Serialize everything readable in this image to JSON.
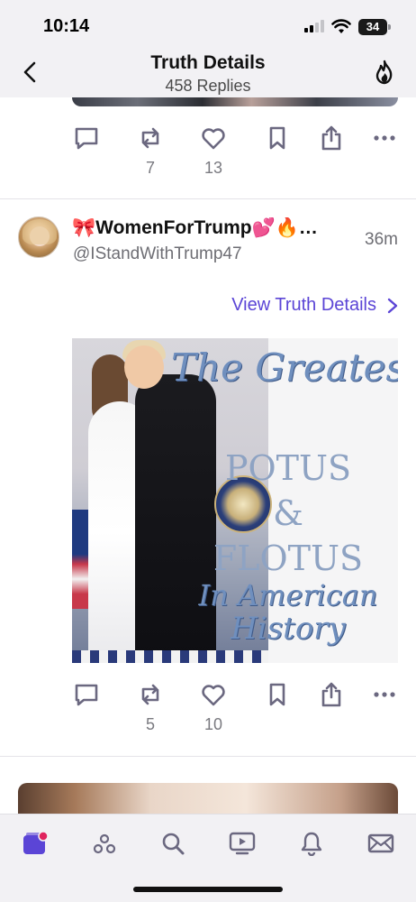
{
  "status_bar": {
    "time": "10:14",
    "battery": "34"
  },
  "header": {
    "title": "Truth Details",
    "subtitle": "458 Replies"
  },
  "prev_post": {
    "replies": "",
    "reposts": "7",
    "likes": "13"
  },
  "post": {
    "display_name": "🎀WomenForTrump💕🔥…",
    "handle": "@IStandWithTrump47",
    "time": "36m",
    "view_details_label": "View Truth Details",
    "image_text": {
      "line1": "The Greatest",
      "line2": "POTUS",
      "line3": "&",
      "line4": "FLOTUS",
      "line5": "In American",
      "line6": "History"
    },
    "replies": "",
    "reposts": "5",
    "likes": "10"
  },
  "tabs": [
    "home",
    "groups",
    "search",
    "tv",
    "notifications",
    "messages"
  ],
  "colors": {
    "accent": "#5b45d6",
    "icon": "#6b6880",
    "text_muted": "#6e6e74"
  }
}
